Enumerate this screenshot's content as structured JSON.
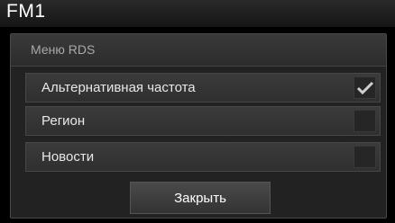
{
  "header": {
    "title": "FM1"
  },
  "dialog": {
    "title": "Меню RDS",
    "options": [
      {
        "label": "Альтернативная частота",
        "checked": true,
        "icon": "check-icon"
      },
      {
        "label": "Регион",
        "checked": false
      },
      {
        "label": "Новости",
        "checked": false
      }
    ],
    "close_label": "Закрыть"
  },
  "colors": {
    "background": "#000000",
    "dialog": "#222222",
    "row": "#3b3b3b",
    "check": "#cfcfcf"
  }
}
